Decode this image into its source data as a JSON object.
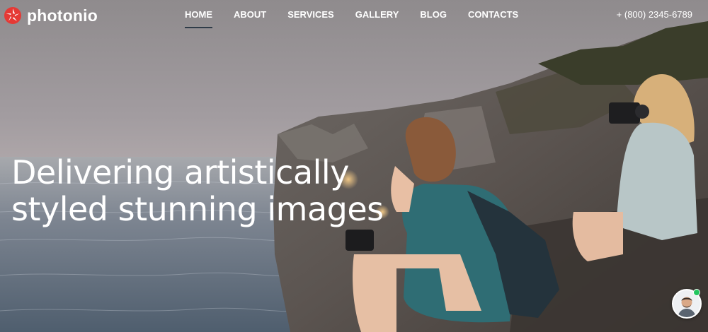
{
  "brand": {
    "name": "photonio",
    "logo_icon": "aperture-icon",
    "accent_color": "#e53935"
  },
  "nav": {
    "items": [
      {
        "label": "HOME",
        "active": true
      },
      {
        "label": "ABOUT",
        "active": false
      },
      {
        "label": "SERVICES",
        "active": false
      },
      {
        "label": "GALLERY",
        "active": false
      },
      {
        "label": "BLOG",
        "active": false
      },
      {
        "label": "CONTACTS",
        "active": false
      }
    ],
    "active_indicator_color": "#2f3b48"
  },
  "contact": {
    "phone": "+ (800) 2345-6789"
  },
  "hero": {
    "headline_line1": "Delivering artistically",
    "headline_line2": "styled stunning images"
  },
  "chat": {
    "avatar_icon": "support-agent-avatar",
    "status": "online",
    "status_color": "#22c55e"
  }
}
